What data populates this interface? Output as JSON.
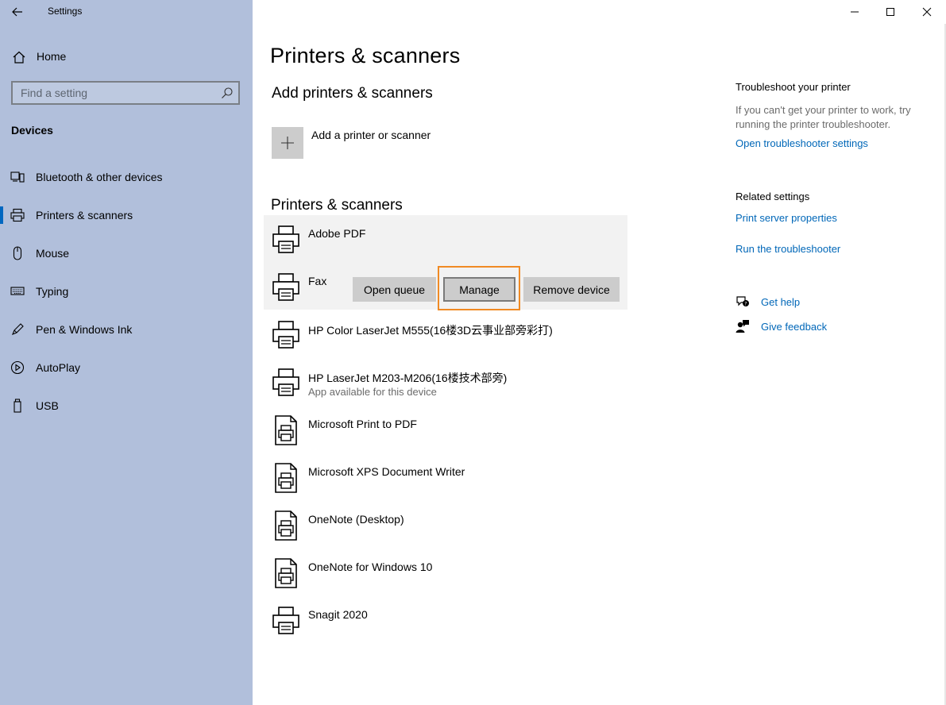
{
  "window": {
    "title": "Settings"
  },
  "sidebar": {
    "home_label": "Home",
    "search_placeholder": "Find a setting",
    "section": "Devices",
    "items": [
      {
        "label": "Bluetooth & other devices",
        "icon": "bluetooth-devices-icon"
      },
      {
        "label": "Printers & scanners",
        "icon": "printer-icon",
        "active": true
      },
      {
        "label": "Mouse",
        "icon": "mouse-icon"
      },
      {
        "label": "Typing",
        "icon": "keyboard-icon"
      },
      {
        "label": "Pen & Windows Ink",
        "icon": "pen-icon"
      },
      {
        "label": "AutoPlay",
        "icon": "autoplay-icon"
      },
      {
        "label": "USB",
        "icon": "usb-icon"
      }
    ]
  },
  "main": {
    "title": "Printers & scanners",
    "add_section": {
      "header": "Add printers & scanners",
      "add_label": "Add a printer or scanner"
    },
    "list_header": "Printers & scanners",
    "devices": [
      {
        "name": "Adobe PDF",
        "type": "printer",
        "selected": true
      },
      {
        "name": "Fax",
        "type": "printer"
      },
      {
        "name": "HP Color LaserJet M555(16楼3D云事业部旁彩打)",
        "type": "printer"
      },
      {
        "name": "HP LaserJet M203-M206(16楼技术部旁)",
        "sub": "App available for this device",
        "type": "printer"
      },
      {
        "name": "Microsoft Print to PDF",
        "type": "document-printer"
      },
      {
        "name": "Microsoft XPS Document Writer",
        "type": "document-printer"
      },
      {
        "name": "OneNote (Desktop)",
        "type": "document-printer"
      },
      {
        "name": "OneNote for Windows 10",
        "type": "document-printer"
      },
      {
        "name": "Snagit 2020",
        "type": "printer"
      }
    ],
    "actions": {
      "open_queue": "Open queue",
      "manage": "Manage",
      "remove": "Remove device"
    }
  },
  "right": {
    "troubleshoot_header": "Troubleshoot your printer",
    "troubleshoot_text": "If you can't get your printer to work, try running the printer troubleshooter.",
    "troubleshoot_link": "Open troubleshooter settings",
    "related_header": "Related settings",
    "related_links": [
      "Print server properties",
      "Run the troubleshooter"
    ],
    "help_link": "Get help",
    "feedback_link": "Give feedback"
  },
  "colors": {
    "sidebar_bg": "#b1bfdb",
    "accent": "#0067b8",
    "highlight": "#f08a24",
    "button_bg": "#cccccc"
  }
}
